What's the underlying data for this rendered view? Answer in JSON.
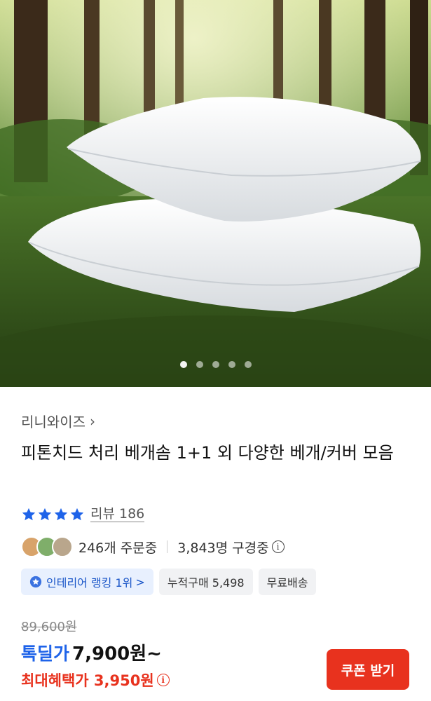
{
  "hero": {
    "image": "white pillows stacked on moss in forest",
    "slide_count": 5,
    "active_slide": 1
  },
  "seller": {
    "name": "리니와이즈",
    "chevron": "chevron-right-icon"
  },
  "product": {
    "title": "피톤치드 처리 베개솜 1+1 외 다양한 베개/커버 모음"
  },
  "rating": {
    "stars": 4,
    "review_label": "리뷰 186"
  },
  "orders": {
    "ordered": "246개 주문중",
    "watching": "3,843명 구경중"
  },
  "chips": [
    {
      "label": "인테리어 랭킹 1위",
      "suffix": ">"
    },
    {
      "label": "누적구매 5,498"
    },
    {
      "label": "무료배송"
    }
  ],
  "price": {
    "original": "89,600원",
    "deal_label": "톡딜가",
    "deal_price": "7,900원~",
    "max_benefit": "최대혜택가 3,950원"
  },
  "coupon_button": {
    "label": "쿠폰 받기"
  },
  "colors": {
    "accent_blue": "#1e63e9",
    "accent_red": "#e8321e"
  }
}
